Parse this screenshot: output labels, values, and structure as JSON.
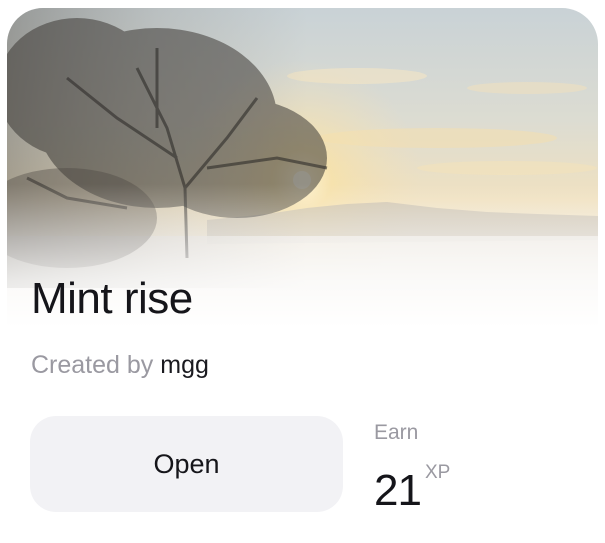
{
  "card": {
    "title": "Mint rise",
    "created_by_prefix": "Created by",
    "creator": "mgg",
    "open_label": "Open",
    "reward": {
      "label": "Earn",
      "amount": "21",
      "unit": "XP"
    },
    "hero_image": "misty sunrise field with bare tree"
  },
  "colors": {
    "title": "#15151a",
    "muted_text": "#9a99a1",
    "button_bg": "#f2f2f5",
    "sky_top": "#cfd6da",
    "sky_glow": "#f3e2bd",
    "tree": "#3c3a36"
  }
}
